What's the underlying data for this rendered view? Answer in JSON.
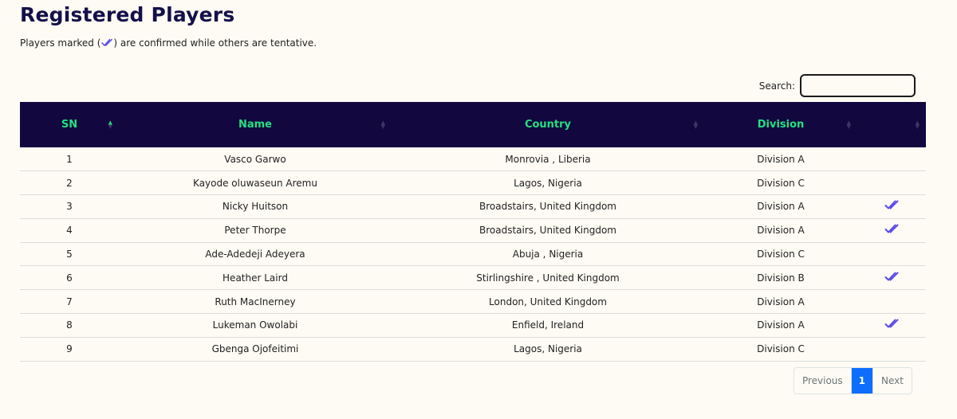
{
  "page": {
    "title": "Registered Players",
    "note_before": "Players marked (",
    "note_after": ") are confirmed while others are tentative."
  },
  "search": {
    "label": "Search:",
    "value": ""
  },
  "table": {
    "headers": {
      "sn": "SN",
      "name": "Name",
      "country": "Country",
      "division": "Division",
      "confirmed": ""
    },
    "rows": [
      {
        "sn": "1",
        "name": "Vasco Garwo",
        "country": "Monrovia , Liberia",
        "division": "Division A",
        "confirmed": false
      },
      {
        "sn": "2",
        "name": "Kayode oluwaseun Aremu",
        "country": "Lagos, Nigeria",
        "division": "Division C",
        "confirmed": false
      },
      {
        "sn": "3",
        "name": "Nicky Huitson",
        "country": "Broadstairs, United Kingdom",
        "division": "Division A",
        "confirmed": true
      },
      {
        "sn": "4",
        "name": "Peter Thorpe",
        "country": "Broadstairs, United Kingdom",
        "division": "Division A",
        "confirmed": true
      },
      {
        "sn": "5",
        "name": "Ade-Adedeji Adeyera",
        "country": "Abuja , Nigeria",
        "division": "Division C",
        "confirmed": false
      },
      {
        "sn": "6",
        "name": "Heather Laird",
        "country": "Stirlingshire , United Kingdom",
        "division": "Division B",
        "confirmed": true
      },
      {
        "sn": "7",
        "name": "Ruth MacInerney",
        "country": "London, United Kingdom",
        "division": "Division A",
        "confirmed": false
      },
      {
        "sn": "8",
        "name": "Lukeman Owolabi",
        "country": "Enfield, Ireland",
        "division": "Division A",
        "confirmed": true
      },
      {
        "sn": "9",
        "name": "Gbenga Ojofeitimi",
        "country": "Lagos, Nigeria",
        "division": "Division C",
        "confirmed": false
      }
    ]
  },
  "pagination": {
    "previous": "Previous",
    "current": "1",
    "next": "Next"
  },
  "icons": {
    "confirmed": "double-check-icon",
    "sort": "sort-arrows-icon"
  },
  "colors": {
    "header_bg": "#12073f",
    "header_text": "#22e07f",
    "check": "#5b4be6",
    "title": "#14104a",
    "active_page": "#0d6efd"
  }
}
